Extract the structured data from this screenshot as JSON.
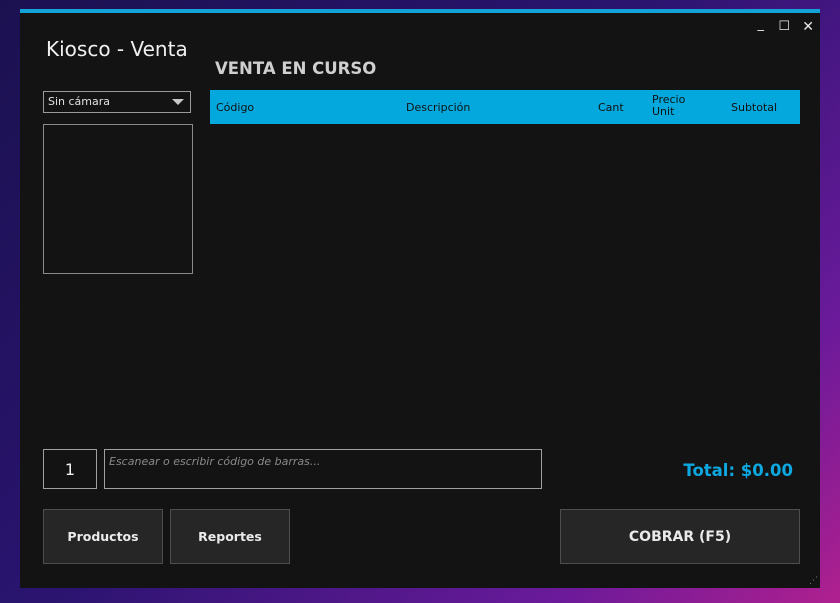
{
  "window": {
    "title": "Kiosco - Venta",
    "controls": {
      "minimize": "_",
      "maximize": "☐",
      "close": "✕"
    }
  },
  "sale": {
    "title": "VENTA EN CURSO",
    "columns": [
      "Código",
      "Descripción",
      "Cant",
      "Precio Unit",
      "Subtotal"
    ],
    "rows": []
  },
  "camera": {
    "selected": "Sin cámara"
  },
  "input": {
    "quantity": "1",
    "barcode_placeholder": "Escanear o escribir código de barras..."
  },
  "total": {
    "label": "Total: $0.00"
  },
  "buttons": {
    "productos": "Productos",
    "reportes": "Reportes",
    "cobrar": "COBRAR (F5)"
  },
  "colors": {
    "accent": "#04a8dd",
    "background": "#131313",
    "total": "#0ea8e0"
  }
}
